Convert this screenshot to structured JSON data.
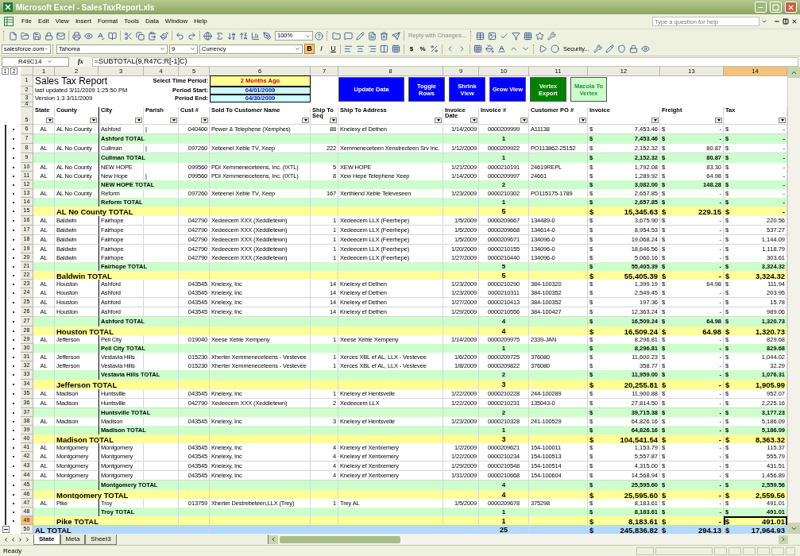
{
  "window": {
    "title": "Microsoft Excel - SalesTaxReport.xls"
  },
  "menu": [
    "File",
    "Edit",
    "View",
    "Insert",
    "Format",
    "Tools",
    "Data",
    "Window",
    "Help"
  ],
  "help_box": {
    "placeholder": "Type a question for help"
  },
  "toolbar": {
    "zoom": "100%",
    "reply": "Reply with Changes...",
    "addin": "salesforce.com",
    "font": "Tahoma",
    "size": "9",
    "style": "Currency",
    "security": "Security...",
    "format_buttons": [
      {
        "label": "B",
        "on": true
      },
      {
        "label": "I",
        "on": false
      },
      {
        "label": "U",
        "on": false
      }
    ],
    "number_buttons": [
      "$",
      "%"
    ]
  },
  "formula_bar": {
    "name_box": "R49C14",
    "insert_function": "fx",
    "formula": "=SUBTOTAL(9,R47C:R[-1]C)"
  },
  "outline_levels": [
    "1",
    "2"
  ],
  "column_headers": [
    {
      "label": "1",
      "selected": false
    },
    {
      "label": "2",
      "selected": false
    },
    {
      "label": "3",
      "selected": false
    },
    {
      "label": "4",
      "selected": false
    },
    {
      "label": "5",
      "selected": false
    },
    {
      "label": "6",
      "selected": false
    },
    {
      "label": "7",
      "selected": false
    },
    {
      "label": "8",
      "selected": false
    },
    {
      "label": "9",
      "selected": false
    },
    {
      "label": "10",
      "selected": false
    },
    {
      "label": "11",
      "selected": false
    },
    {
      "label": "12",
      "selected": false
    },
    {
      "label": "13",
      "selected": false
    },
    {
      "label": "14",
      "selected": true
    }
  ],
  "report": {
    "row_numbers": [
      "1",
      "2",
      "3",
      "4"
    ],
    "title": "Sales Tax Report",
    "updated": "last updated 3/11/2009 1:25:50 PM",
    "version": "Version 1.3 3/11/2009",
    "fields": [
      {
        "label": "Select Time Period:",
        "value": "2 Months Ago",
        "kind": "choice"
      },
      {
        "label": "Period Start:",
        "value": "04/01/2009",
        "kind": "date"
      },
      {
        "label": "Period End:",
        "value": "04/30/2009",
        "kind": "date"
      }
    ],
    "buttons": [
      {
        "label": "Update Data",
        "color": "#0000ff"
      },
      {
        "label": "Toggle Rows",
        "color": "#0000ff"
      },
      {
        "label": "Shrink View",
        "color": "#0000ff"
      },
      {
        "label": "Grow View",
        "color": "#0000ff"
      },
      {
        "label": "Vertex Export",
        "color": "#008000"
      },
      {
        "label": "Macola To Vertex",
        "color": "#ccffcc"
      }
    ]
  },
  "heading_row": "5",
  "headings": [
    "State",
    "County",
    "City",
    "Parish",
    "Cust #",
    "Sold To Customer Name",
    "Ship To Seq",
    "Ship To Address",
    "Invoice Date",
    "Invoice #",
    "Customer PO #",
    "Invoice",
    "Freight",
    "Tax"
  ],
  "rows": [
    {
      "row": "6",
      "kind": "data",
      "selected": false,
      "cells": [
        "AL",
        "AL No County",
        "Ashford",
        "|",
        "040400",
        "Pewer & Telephene (Xemphes)",
        "88",
        "Knelexy ef Dethen",
        "1/14/2009",
        "0000209999",
        "A11138"
      ],
      "amounts": [
        [
          "$",
          "7,453.46"
        ],
        [
          "$",
          "-"
        ],
        [
          "$",
          "-"
        ]
      ]
    },
    {
      "row": "7",
      "kind": "city_total",
      "selected": false,
      "label": "Ashford TOTAL",
      "count": "1",
      "amounts": [
        [
          "$",
          "7,453.46"
        ],
        [
          "$",
          "-"
        ],
        [
          "$",
          "-"
        ]
      ]
    },
    {
      "row": "8",
      "kind": "data",
      "selected": false,
      "cells": [
        "AL",
        "AL No County",
        "Cullman",
        "|",
        "097260",
        "Xeteenel Xeble TV, Xeep",
        "222",
        "Xemmeneceteen Xenstrecteen Srv Inc.",
        "1/12/2009",
        "0000209922",
        "PO113862-25152"
      ],
      "amounts": [
        [
          "$",
          "2,152.32"
        ],
        [
          "$",
          "80.87"
        ],
        [
          "$",
          "-"
        ]
      ]
    },
    {
      "row": "9",
      "kind": "city_total",
      "selected": false,
      "label": "Cullman TOTAL",
      "count": "1",
      "amounts": [
        [
          "$",
          "2,152.32"
        ],
        [
          "$",
          "80.87"
        ],
        [
          "$",
          "-"
        ]
      ]
    },
    {
      "row": "10",
      "kind": "data",
      "selected": false,
      "cells": [
        "AL",
        "AL No County",
        "NEW HOPE",
        null,
        "099560",
        "PDI Xemmeneceteens, Inc. (IXTL)",
        "5",
        "XEW HOPE",
        "1/21/2009",
        "0000210191",
        "24619REPL"
      ],
      "amounts": [
        [
          "$",
          "1,792.08"
        ],
        [
          "$",
          "83.30"
        ],
        [
          "$",
          "-"
        ]
      ]
    },
    {
      "row": "11",
      "kind": "data",
      "selected": false,
      "cells": [
        "AL",
        "AL No County",
        "New Hope",
        "|",
        "099560",
        "PDI Xemmeneceteens, Inc. (IXTL)",
        "8",
        "Xew Hepe Telephene Xeep",
        "1/14/2009",
        "0000209997",
        "24661"
      ],
      "amounts": [
        [
          "$",
          "1,289.92"
        ],
        [
          "$",
          "64.98"
        ],
        [
          "$",
          "-"
        ]
      ]
    },
    {
      "row": "12",
      "kind": "city_total",
      "selected": false,
      "label": "NEW HOPE TOTAL",
      "count": "2",
      "amounts": [
        [
          "$",
          "3,082.00"
        ],
        [
          "$",
          "148.28"
        ],
        [
          "$",
          "-"
        ]
      ]
    },
    {
      "row": "13",
      "kind": "data",
      "selected": false,
      "cells": [
        "AL",
        "AL No County",
        "Reform",
        null,
        "097260",
        "Xeteenel Xeble TV, Xeep",
        "167",
        "Xerthlend Xeble Televeseen",
        "1/23/2009",
        "0000210302",
        "PO115175-1789"
      ],
      "amounts": [
        [
          "$",
          "2,657.85"
        ],
        [
          "$",
          "-"
        ],
        [
          "$",
          "-"
        ]
      ]
    },
    {
      "row": "14",
      "kind": "city_total",
      "selected": false,
      "label": "Reform TOTAL",
      "count": "1",
      "amounts": [
        [
          "$",
          "2,657.85"
        ],
        [
          "$",
          "-"
        ],
        [
          "$",
          "-"
        ]
      ]
    },
    {
      "row": "15",
      "kind": "county_total",
      "selected": false,
      "label": "AL No County TOTAL",
      "count": "5",
      "amounts": [
        [
          "$",
          "15,345.63"
        ],
        [
          "$",
          "229.15"
        ],
        [
          "$",
          "-"
        ]
      ]
    },
    {
      "row": "16",
      "kind": "data",
      "selected": false,
      "cells": [
        "AL",
        "Baldwin",
        "Fairhope",
        null,
        "042790",
        "Xedeecem XXX (Xeddletewn)",
        "1",
        "Xedeecem LLX (Feerhepe)",
        "1/5/2009",
        "0000209667",
        "134489-0"
      ],
      "amounts": [
        [
          "$",
          "3,675.90"
        ],
        [
          "$",
          "-"
        ],
        [
          "$",
          "220.56"
        ]
      ]
    },
    {
      "row": "17",
      "kind": "data",
      "selected": false,
      "cells": [
        "AL",
        "Baldwin",
        "Fairhope",
        null,
        "042790",
        "Xedeecem XXX (Xeddletewn)",
        "1",
        "Xedeecem LLX (Feerhepe)",
        "1/5/2009",
        "0000209668",
        "134614-0"
      ],
      "amounts": [
        [
          "$",
          "8,954.53"
        ],
        [
          "$",
          "-"
        ],
        [
          "$",
          "537.27"
        ]
      ]
    },
    {
      "row": "18",
      "kind": "data",
      "selected": false,
      "cells": [
        "AL",
        "Baldwin",
        "Fairhope",
        null,
        "042790",
        "Xedeecem XXX (Xeddletewn)",
        "1",
        "Xedeecem LLX (Feerhepe)",
        "1/5/2009",
        "0000209671",
        "134096-0"
      ],
      "amounts": [
        [
          "$",
          "19,068.24"
        ],
        [
          "$",
          "-"
        ],
        [
          "$",
          "1,144.09"
        ]
      ]
    },
    {
      "row": "19",
      "kind": "data",
      "selected": false,
      "cells": [
        "AL",
        "Baldwin",
        "Fairhope",
        null,
        "042790",
        "Xedeecem XXX (Xeddletewn)",
        "1",
        "Xedeecem LLX (Feerhepe)",
        "1/20/2009",
        "0000210155",
        "134096-0"
      ],
      "amounts": [
        [
          "$",
          "18,646.56"
        ],
        [
          "$",
          "-"
        ],
        [
          "$",
          "1,118.79"
        ]
      ]
    },
    {
      "row": "20",
      "kind": "data",
      "selected": false,
      "cells": [
        "AL",
        "Baldwin",
        "Fairhope",
        null,
        "042790",
        "Xedeecem XXX (Xeddletewn)",
        "1",
        "Xedeecem LLX (Feerhepe)",
        "1/27/2009",
        "0000210440",
        "134096-0"
      ],
      "amounts": [
        [
          "$",
          "5,060.16"
        ],
        [
          "$",
          "-"
        ],
        [
          "$",
          "303.61"
        ]
      ]
    },
    {
      "row": "21",
      "kind": "city_total",
      "selected": false,
      "label": "Fairhope TOTAL",
      "count": "5",
      "amounts": [
        [
          "$",
          "55,405.39"
        ],
        [
          "$",
          "-"
        ],
        [
          "$",
          "3,324.32"
        ]
      ]
    },
    {
      "row": "22",
      "kind": "county_total",
      "selected": false,
      "label": "Baldwin TOTAL",
      "count": "5",
      "amounts": [
        [
          "$",
          "55,405.39"
        ],
        [
          "$",
          "-"
        ],
        [
          "$",
          "3,324.32"
        ]
      ]
    },
    {
      "row": "23",
      "kind": "data",
      "selected": false,
      "cells": [
        "AL",
        "Houston",
        "Ashford",
        null,
        "043545",
        "Knelexy, Inc",
        "14",
        "Knelexy ef Dethen",
        "1/23/2009",
        "0000210290",
        "384-100320"
      ],
      "amounts": [
        [
          "$",
          "1,399.19"
        ],
        [
          "$",
          "64.98"
        ],
        [
          "$",
          "111.94"
        ]
      ]
    },
    {
      "row": "24",
      "kind": "data",
      "selected": false,
      "cells": [
        "AL",
        "Houston",
        "Ashford",
        null,
        "043545",
        "Knelexy, Inc",
        "14",
        "Knelexy ef Dethen",
        "1/23/2009",
        "0000210311",
        "384-100352"
      ],
      "amounts": [
        [
          "$",
          "2,549.45"
        ],
        [
          "$",
          "-"
        ],
        [
          "$",
          "203.95"
        ]
      ]
    },
    {
      "row": "25",
      "kind": "data",
      "selected": false,
      "cells": [
        "AL",
        "Houston",
        "Ashford",
        null,
        "043545",
        "Knelexy, Inc",
        "14",
        "Knelexy ef Dethen",
        "1/27/2009",
        "0000210413",
        "384-100352"
      ],
      "amounts": [
        [
          "$",
          "197.36"
        ],
        [
          "$",
          "-"
        ],
        [
          "$",
          "15.78"
        ]
      ]
    },
    {
      "row": "26",
      "kind": "data",
      "selected": false,
      "cells": [
        "AL",
        "Houston",
        "Ashford",
        null,
        "043545",
        "Knelexy, Inc",
        "14",
        "Knelexy ef Dethen",
        "1/29/2009",
        "0000210556",
        "384-100427"
      ],
      "amounts": [
        [
          "$",
          "12,363.24"
        ],
        [
          "$",
          "-"
        ],
        [
          "$",
          "989.06"
        ]
      ]
    },
    {
      "row": "27",
      "kind": "city_total",
      "selected": false,
      "label": "Ashford TOTAL",
      "count": "4",
      "amounts": [
        [
          "$",
          "16,509.24"
        ],
        [
          "$",
          "64.98"
        ],
        [
          "$",
          "1,320.73"
        ]
      ]
    },
    {
      "row": "28",
      "kind": "county_total",
      "selected": false,
      "label": "Houston TOTAL",
      "count": "4",
      "amounts": [
        [
          "$",
          "16,509.24"
        ],
        [
          "$",
          "64.98"
        ],
        [
          "$",
          "1,320.73"
        ]
      ]
    },
    {
      "row": "29",
      "kind": "data",
      "selected": false,
      "cells": [
        "AL",
        "Jefferson",
        "Pell City",
        null,
        "019040",
        "Xeese Xeble Xempeny",
        "1",
        "Xeese Xeble Xempeny",
        "1/14/2009",
        "0000209975",
        "2339-JAN"
      ],
      "amounts": [
        [
          "$",
          "8,296.81"
        ],
        [
          "$",
          "-"
        ],
        [
          "$",
          "829.68"
        ]
      ]
    },
    {
      "row": "30",
      "kind": "city_total",
      "selected": false,
      "label": "Pell City TOTAL",
      "count": "1",
      "amounts": [
        [
          "$",
          "8,296.81"
        ],
        [
          "$",
          "-"
        ],
        [
          "$",
          "829.68"
        ]
      ]
    },
    {
      "row": "31",
      "kind": "data",
      "selected": false,
      "cells": [
        "AL",
        "Jefferson",
        "Vestavia Hills",
        null,
        "015230",
        "Xherter Xemmeneceteens - Vestevee",
        "1",
        "Xerces XBL ef AL, LLX - Vestevee",
        "1/6/2009",
        "0000209725",
        "376080"
      ],
      "amounts": [
        [
          "$",
          "11,600.23"
        ],
        [
          "$",
          "-"
        ],
        [
          "$",
          "1,044.02"
        ]
      ]
    },
    {
      "row": "32",
      "kind": "data",
      "selected": false,
      "cells": [
        "AL",
        "Jefferson",
        "Vestavia Hills",
        null,
        "015230",
        "Xherter Xemmeneceteens - Vestevee",
        "1",
        "Xerces XBL ef AL, LLX - Vestevee",
        "1/8/2009",
        "0000209822",
        "376080"
      ],
      "amounts": [
        [
          "$",
          "358.77"
        ],
        [
          "$",
          "-"
        ],
        [
          "$",
          "32.29"
        ]
      ]
    },
    {
      "row": "33",
      "kind": "city_total",
      "selected": false,
      "label": "Vestavia Hills TOTAL",
      "count": "2",
      "amounts": [
        [
          "$",
          "11,959.00"
        ],
        [
          "$",
          "-"
        ],
        [
          "$",
          "1,076.31"
        ]
      ]
    },
    {
      "row": "34",
      "kind": "county_total",
      "selected": false,
      "label": "Jefferson TOTAL",
      "count": "3",
      "amounts": [
        [
          "$",
          "20,255.81"
        ],
        [
          "$",
          "-"
        ],
        [
          "$",
          "1,905.99"
        ]
      ]
    },
    {
      "row": "35",
      "kind": "data",
      "selected": false,
      "cells": [
        "AL",
        "Madison",
        "Huntsville",
        null,
        "043545",
        "Knelexy, Inc",
        "1",
        "Knelexy ef Hentsvelle",
        "1/22/2009",
        "0000210228",
        "244-100289"
      ],
      "amounts": [
        [
          "$",
          "11,900.88"
        ],
        [
          "$",
          "-"
        ],
        [
          "$",
          "952.07"
        ]
      ]
    },
    {
      "row": "36",
      "kind": "data",
      "selected": false,
      "cells": [
        "AL",
        "Madison",
        "Huntsville",
        null,
        "042790",
        "Xedeecem XXX (Xeddletewn)",
        "2",
        "Xedeecem LLX",
        "1/22/2009",
        "0000210231",
        "135043-0"
      ],
      "amounts": [
        [
          "$",
          "27,814.50"
        ],
        [
          "$",
          "-"
        ],
        [
          "$",
          "2,225.16"
        ]
      ]
    },
    {
      "row": "37",
      "kind": "city_total",
      "selected": false,
      "label": "Huntsville TOTAL",
      "count": "2",
      "amounts": [
        [
          "$",
          "39,715.38"
        ],
        [
          "$",
          "-"
        ],
        [
          "$",
          "3,177.23"
        ]
      ]
    },
    {
      "row": "38",
      "kind": "data",
      "selected": false,
      "cells": [
        "AL",
        "Madison",
        "Madison",
        null,
        "043545",
        "Knelexy, Inc",
        "3",
        "Knelexy ef Hentsvelle",
        "1/23/2009",
        "0000210328",
        "241-100529"
      ],
      "amounts": [
        [
          "$",
          "64,826.16"
        ],
        [
          "$",
          "-"
        ],
        [
          "$",
          "5,186.09"
        ]
      ]
    },
    {
      "row": "39",
      "kind": "city_total",
      "selected": false,
      "label": "Madison TOTAL",
      "count": "1",
      "amounts": [
        [
          "$",
          "64,826.16"
        ],
        [
          "$",
          "-"
        ],
        [
          "$",
          "5,186.09"
        ]
      ]
    },
    {
      "row": "40",
      "kind": "county_total",
      "selected": false,
      "label": "Madison TOTAL",
      "count": "3",
      "amounts": [
        [
          "$",
          "104,541.54"
        ],
        [
          "$",
          "-"
        ],
        [
          "$",
          "8,363.32"
        ]
      ]
    },
    {
      "row": "41",
      "kind": "data",
      "selected": false,
      "cells": [
        "AL",
        "Montgomery",
        "Montgomery",
        null,
        "043545",
        "Knelexy, Inc",
        "4",
        "Knelexy ef Xentxemery",
        "1/2/2009",
        "0000209621",
        "154-100011"
      ],
      "amounts": [
        [
          "$",
          "1,153.79"
        ],
        [
          "$",
          "-"
        ],
        [
          "$",
          "115.37"
        ]
      ]
    },
    {
      "row": "42",
      "kind": "data",
      "selected": false,
      "cells": [
        "AL",
        "Montgomery",
        "Montgomery",
        null,
        "043545",
        "Knelexy, Inc",
        "4",
        "Knelexy ef Xentxemery",
        "1/22/2009",
        "0000210234",
        "154-100513"
      ],
      "amounts": [
        [
          "$",
          "5,557.87"
        ],
        [
          "$",
          "-"
        ],
        [
          "$",
          "555.79"
        ]
      ]
    },
    {
      "row": "43",
      "kind": "data",
      "selected": false,
      "cells": [
        "AL",
        "Montgomery",
        "Montgomery",
        null,
        "043545",
        "Knelexy, Inc",
        "4",
        "Knelexy ef Xentxemery",
        "1/29/2009",
        "0000210548",
        "154-100514"
      ],
      "amounts": [
        [
          "$",
          "4,315.00"
        ],
        [
          "$",
          "-"
        ],
        [
          "$",
          "431.51"
        ]
      ]
    },
    {
      "row": "44",
      "kind": "data",
      "selected": false,
      "cells": [
        "AL",
        "Montgomery",
        "Montgomery",
        null,
        "043545",
        "Knelexy, Inc",
        "4",
        "Knelexy ef Xentxemery",
        "1/31/2009",
        "0000210668",
        "154-100604"
      ],
      "amounts": [
        [
          "$",
          "14,568.94"
        ],
        [
          "$",
          "-"
        ],
        [
          "$",
          "1,456.89"
        ]
      ]
    },
    {
      "row": "45",
      "kind": "city_total",
      "selected": false,
      "label": "Montgomery TOTAL",
      "count": "4",
      "amounts": [
        [
          "$",
          "25,595.60"
        ],
        [
          "$",
          "-"
        ],
        [
          "$",
          "2,559.56"
        ]
      ]
    },
    {
      "row": "46",
      "kind": "county_total",
      "selected": false,
      "label": "Montgomery TOTAL",
      "count": "4",
      "amounts": [
        [
          "$",
          "25,595.60"
        ],
        [
          "$",
          "-"
        ],
        [
          "$",
          "2,559.56"
        ]
      ]
    },
    {
      "row": "47",
      "kind": "data",
      "selected": false,
      "cells": [
        "AL",
        "Pike",
        "Troy",
        null,
        "013759",
        "Xherter Destrebeteen,LLX (Trey)",
        "1",
        "Trey AL",
        "1/5/2009",
        "0000209678",
        "375298"
      ],
      "amounts": [
        [
          "$",
          "8,183.61"
        ],
        [
          "$",
          "-"
        ],
        [
          "$",
          "491.01"
        ]
      ]
    },
    {
      "row": "48",
      "kind": "city_total",
      "selected": false,
      "label": "Troy TOTAL",
      "count": "1",
      "amounts": [
        [
          "$",
          "8,183.61"
        ],
        [
          "$",
          "-"
        ],
        [
          "$",
          "491.01"
        ]
      ]
    },
    {
      "row": "49",
      "kind": "county_total",
      "selected": true,
      "label": "Pike TOTAL",
      "count": "1",
      "amounts": [
        [
          "$",
          "8,183.61"
        ],
        [
          "$",
          "-"
        ],
        [
          "$",
          "491.01"
        ]
      ]
    },
    {
      "row": "50",
      "kind": "state_total",
      "selected": false,
      "label": "AL TOTAL",
      "count": "25",
      "amounts": [
        [
          "$",
          "245,836.82"
        ],
        [
          "$",
          "294.13"
        ],
        [
          "$",
          "17,964.93"
        ]
      ]
    }
  ],
  "sheet_tabs": [
    {
      "label": "State",
      "selected": true
    },
    {
      "label": "Meta",
      "selected": false
    },
    {
      "label": "Sheet3",
      "selected": false
    }
  ],
  "status_bar": "Ready"
}
